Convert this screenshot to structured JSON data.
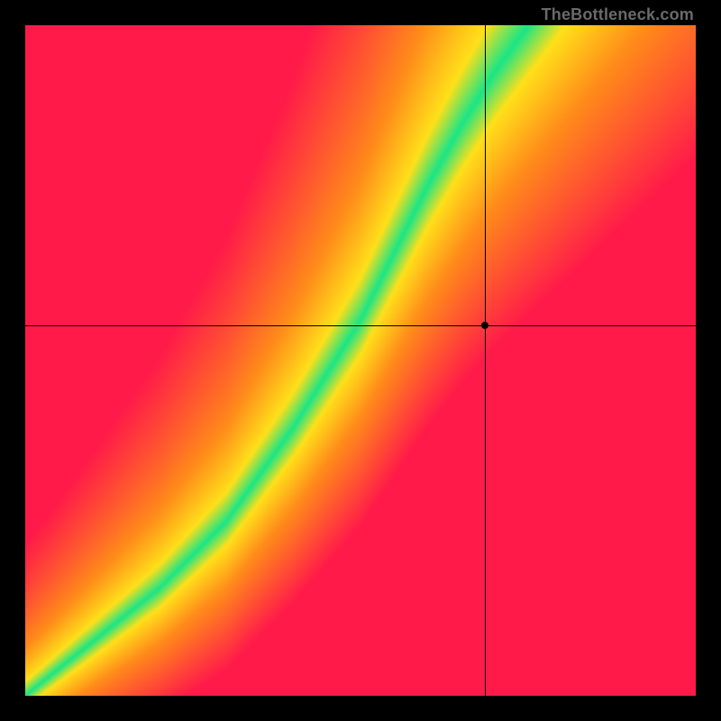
{
  "watermark": "TheBottleneck.com",
  "chart_data": {
    "type": "heatmap",
    "title": "",
    "xlabel": "",
    "ylabel": "",
    "xlim": [
      0,
      100
    ],
    "ylim": [
      0,
      100
    ],
    "grid": false,
    "crosshair": {
      "x": 68.5,
      "y": 55.2
    },
    "marker": {
      "x": 68.5,
      "y": 55.2
    },
    "optimal_curve": {
      "description": "Curved band where optimal match occurs (green region)",
      "points": [
        {
          "x": 0,
          "y": 0
        },
        {
          "x": 10,
          "y": 8
        },
        {
          "x": 20,
          "y": 16
        },
        {
          "x": 30,
          "y": 26
        },
        {
          "x": 40,
          "y": 40
        },
        {
          "x": 50,
          "y": 56
        },
        {
          "x": 55,
          "y": 66
        },
        {
          "x": 60,
          "y": 76
        },
        {
          "x": 65,
          "y": 85
        },
        {
          "x": 70,
          "y": 93
        },
        {
          "x": 75,
          "y": 100
        }
      ],
      "band_width": 6
    },
    "color_scale": {
      "poor": "#ff1a4a",
      "fair": "#ff8c1a",
      "ok": "#ffe01a",
      "good": "#1ae687"
    }
  }
}
